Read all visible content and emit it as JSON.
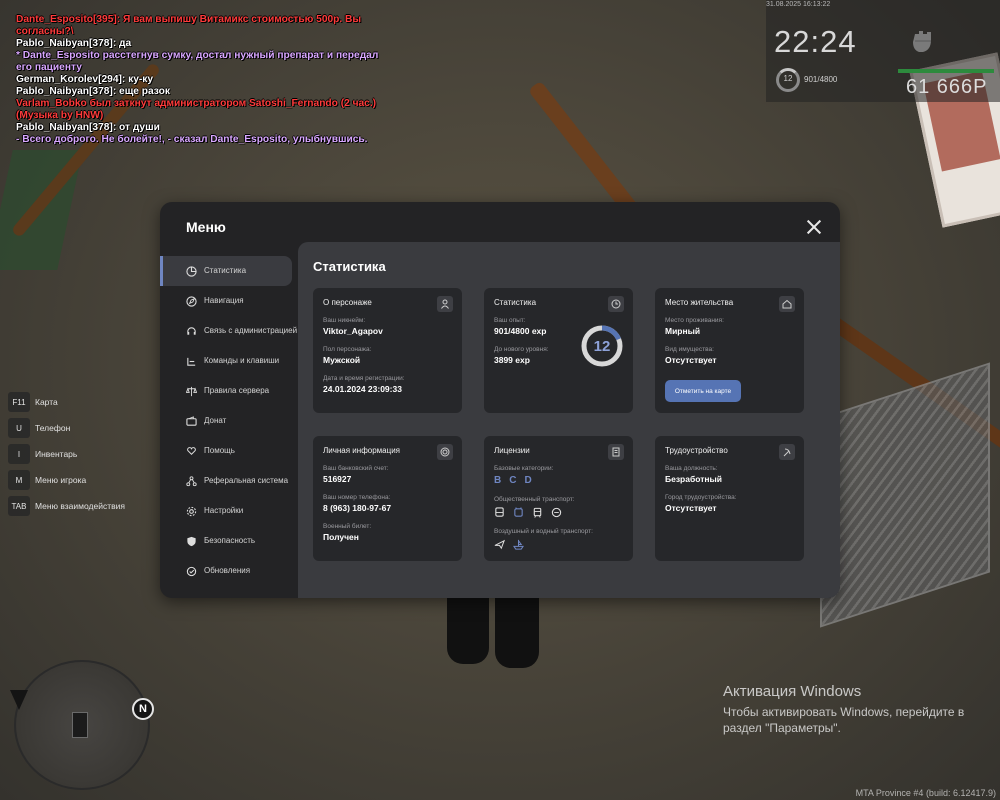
{
  "chat": [
    {
      "text": "Dante_Esposito[395]: Я вам выпишу Витамикс стоимостью 500р. Вы согласны?\\",
      "color": "red"
    },
    {
      "text": "Pablo_Naibyan[378]: да",
      "color": "white"
    },
    {
      "text": "* Dante_Esposito расстегнув сумку, достал нужный препарат и передал его пациенту",
      "color": "pink"
    },
    {
      "text": "German_Korolev[294]: ку-ку",
      "color": "white"
    },
    {
      "text": "Pablo_Naibyan[378]: еще разок",
      "color": "white"
    },
    {
      "text": "Varlam_Bobko был заткнут администратором Satoshi_Fernando (2 час.) (Музыка by HNW)",
      "color": "red"
    },
    {
      "text": "Pablo_Naibyan[378]: от души",
      "color": "white"
    },
    {
      "text": "- Всего доброго. Не болейте!, - сказал Dante_Esposito, улыбнувшись.",
      "color": "pink"
    }
  ],
  "hud": {
    "date": "31.08.2025 16:13:22",
    "clock": "22:24",
    "level": "12",
    "exp": "901/4800",
    "money": "61 666Р"
  },
  "keybinds": [
    {
      "key": "F11",
      "label": "Карта"
    },
    {
      "key": "U",
      "label": "Телефон"
    },
    {
      "key": "I",
      "label": "Инвентарь"
    },
    {
      "key": "M",
      "label": "Меню игрока"
    },
    {
      "key": "TAB",
      "label": "Меню взаимодействия"
    }
  ],
  "minimap": {
    "north": "N"
  },
  "activation": {
    "title": "Активация Windows",
    "text": "Чтобы активировать Windows, перейдите в раздел \"Параметры\"."
  },
  "build": "MTA Province #4 (build: 6.12417.9)",
  "menu": {
    "title": "Меню",
    "sidebar": [
      {
        "label": "Статистика",
        "icon": "pie-chart-icon",
        "active": true
      },
      {
        "label": "Навигация",
        "icon": "compass-icon"
      },
      {
        "label": "Связь с администрацией",
        "icon": "headset-icon"
      },
      {
        "label": "Команды и клавиши",
        "icon": "command-icon"
      },
      {
        "label": "Правила сервера",
        "icon": "scales-icon"
      },
      {
        "label": "Донат",
        "icon": "wallet-icon"
      },
      {
        "label": "Помощь",
        "icon": "hands-heart-icon"
      },
      {
        "label": "Реферальная система",
        "icon": "network-icon"
      },
      {
        "label": "Настройки",
        "icon": "gear-icon"
      },
      {
        "label": "Безопасность",
        "icon": "shield-icon"
      },
      {
        "label": "Обновления",
        "icon": "refresh-icon"
      }
    ],
    "content_title": "Статистика",
    "cards": {
      "character": {
        "title": "О персонаже",
        "nick_label": "Ваш никнейм:",
        "nick": "Viktor_Agapov",
        "gender_label": "Пол персонажа:",
        "gender": "Мужской",
        "reg_label": "Дата и время регистрации:",
        "reg": "24.01.2024 23:09:33"
      },
      "stats": {
        "title": "Статистика",
        "exp_label": "Ваш опыт:",
        "exp": "901/4800 exp",
        "next_label": "До нового уровня:",
        "next": "3899 exp",
        "level": "12",
        "progress": 0.1877
      },
      "residence": {
        "title": "Место жительства",
        "place_label": "Место проживания:",
        "place": "Мирный",
        "property_label": "Вид имущества:",
        "property": "Отсутствует",
        "button": "Отметить на карте"
      },
      "personal": {
        "title": "Личная информация",
        "bank_label": "Ваш банковский счет:",
        "bank": "516927",
        "phone_label": "Ваш номер телефона:",
        "phone": "8 (963) 180-97-67",
        "military_label": "Военный билет:",
        "military": "Получен"
      },
      "licenses": {
        "title": "Лицензии",
        "base_label": "Базовые категории:",
        "categories": [
          "B",
          "C",
          "D"
        ],
        "public_label": "Общественный транспорт:",
        "public_icons": [
          "bus-icon",
          "trolleybus-icon",
          "tram-icon",
          "taxi-icon"
        ],
        "air_label": "Воздушный и водный транспорт:",
        "air_icons": [
          "plane-icon",
          "boat-icon"
        ]
      },
      "job": {
        "title": "Трудоустройство",
        "position_label": "Ваша должность:",
        "position": "Безработный",
        "city_label": "Город трудоустройства:",
        "city": "Отсутствует"
      }
    }
  }
}
